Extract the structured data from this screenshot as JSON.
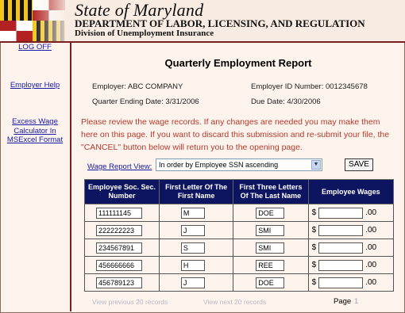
{
  "header": {
    "state_title": "State of Maryland",
    "department": "DEPARTMENT OF LABOR, LICENSING, AND REGULATION",
    "division": "Division of Unemployment Insurance"
  },
  "sidebar": {
    "items": [
      {
        "label": "LOG OFF"
      },
      {
        "label": "Employer Help"
      },
      {
        "label": "Excess Wage Calculator In MSExcel Format"
      }
    ]
  },
  "report": {
    "title": "Quarterly Employment Report",
    "employer": "Employer: ABC COMPANY",
    "employer_id": "Employer ID Number: 0012345678",
    "quarter_ending": "Quarter Ending Date: 3/31/2006",
    "due_date": "Due Date: 4/30/2006",
    "notice": "Please review the wage records. If any changes are needed you may make them here on this page. If you want to discard this submission and re-submit your file, the \"CANCEL\" button below will return you to the opening page."
  },
  "controls": {
    "view_label": "Wage Report View:",
    "view_selected": "In order by Employee SSN ascending",
    "save_label": "SAVE"
  },
  "table": {
    "headers": [
      "Employee Soc. Sec. Number",
      "First Letter Of The First Name",
      "First Three Letters Of The Last Name",
      "Employee Wages"
    ],
    "currency_symbol": "$",
    "cents": ".00",
    "rows": [
      {
        "ssn": "111111145",
        "first": "M",
        "last": "DOE",
        "wages": ""
      },
      {
        "ssn": "222222223",
        "first": "J",
        "last": "SMI",
        "wages": ""
      },
      {
        "ssn": "234567891",
        "first": "S",
        "last": "SMI",
        "wages": ""
      },
      {
        "ssn": "456666666",
        "first": "H",
        "last": "REE",
        "wages": ""
      },
      {
        "ssn": "456789123",
        "first": "J",
        "last": "DOE",
        "wages": ""
      }
    ]
  },
  "pager": {
    "prev": "View previous 20 records",
    "next": "View next 20 records",
    "page_label": "Page",
    "page_number": "1"
  }
}
